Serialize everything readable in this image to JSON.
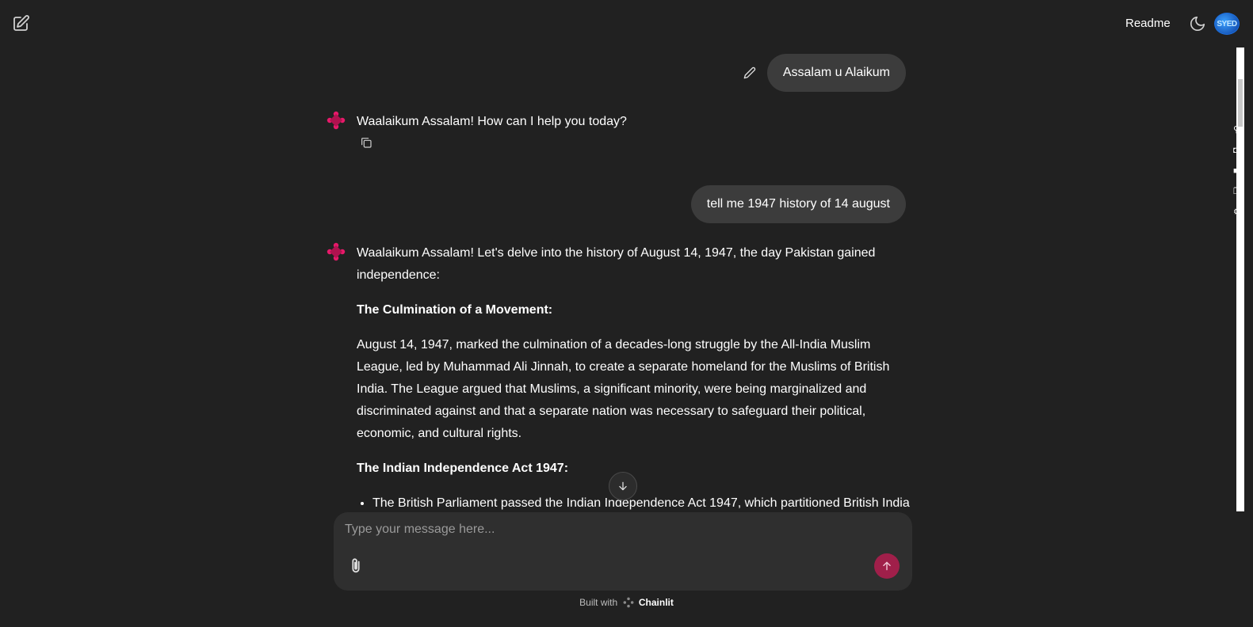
{
  "header": {
    "readme_label": "Readme",
    "avatar_text": "SYED",
    "icons": [
      "new-chat-icon",
      "moon-icon"
    ]
  },
  "messages": [
    {
      "role": "user",
      "text": "Assalam u Alaikum"
    },
    {
      "role": "assistant",
      "text": "Waalaikum Assalam! How can I help you today?"
    },
    {
      "role": "user",
      "text": "tell me 1947 history of 14 august"
    },
    {
      "role": "assistant",
      "intro": "Waalaikum Assalam! Let's delve into the history of August 14, 1947, the day Pakistan gained independence:",
      "heading1": "The Culmination of a Movement:",
      "para1": "August 14, 1947, marked the culmination of a decades-long struggle by the All-India Muslim League, led by Muhammad Ali Jinnah, to create a separate homeland for the Muslims of British India.  The League argued that Muslims, a significant minority, were being marginalized and discriminated against and that a separate nation was necessary to safeguard their political, economic, and cultural rights.",
      "heading2": "The Indian Independence Act 1947:",
      "bullet1": "The British Parliament passed the Indian Independence Act 1947, which partitioned British India"
    }
  ],
  "composer": {
    "placeholder": "Type your message here..."
  },
  "footer": {
    "prefix": "Built with",
    "brand": "Chainlit"
  },
  "colors": {
    "background": "#212121",
    "bubble": "#3c3c3c",
    "composer": "#2f2f2f",
    "send_button": "#a01f4a",
    "bot_logo": "#e8196a"
  }
}
